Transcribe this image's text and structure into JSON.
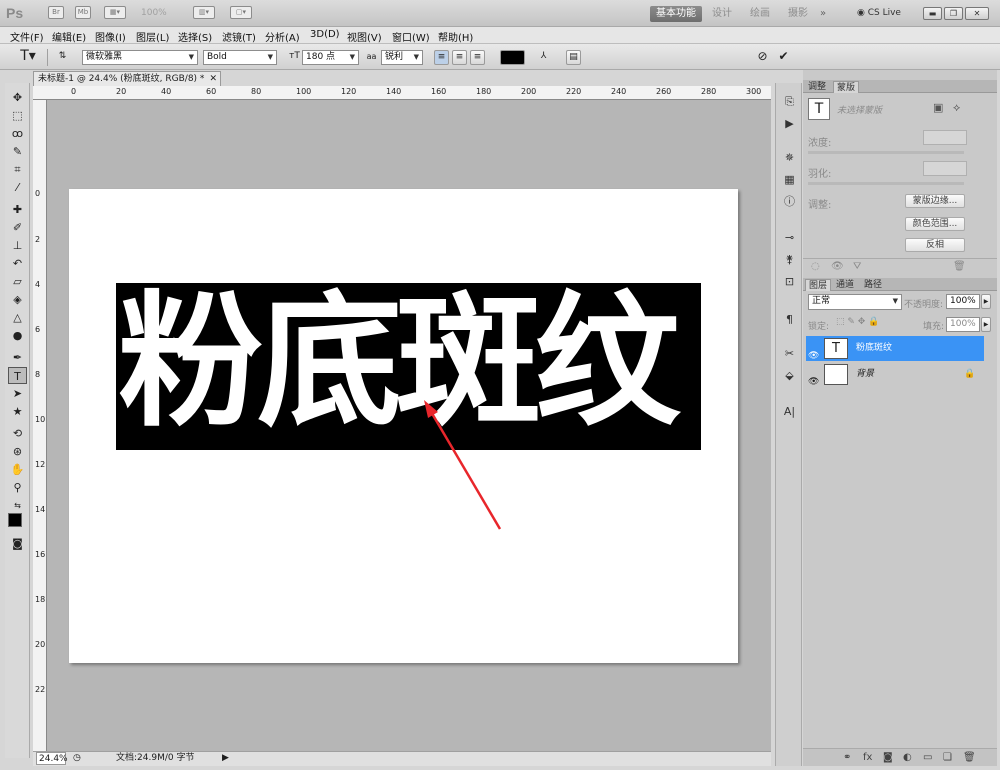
{
  "app": {
    "logo": "Ps",
    "zoom": "100%",
    "workspaces": [
      "基本功能",
      "设计",
      "绘画",
      "摄影"
    ],
    "cs_live": "CS Live"
  },
  "menu": [
    "文件(F)",
    "编辑(E)",
    "图像(I)",
    "图层(L)",
    "选择(S)",
    "滤镜(T)",
    "分析(A)",
    "3D(D)",
    "视图(V)",
    "窗口(W)",
    "帮助(H)"
  ],
  "options": {
    "font_family": "微软雅黑",
    "font_style": "Bold",
    "font_size": "180 点",
    "aa_label": "a",
    "aa": "锐利",
    "color": "#000000"
  },
  "document": {
    "tab_title": "未标题-1 @ 24.4% (粉底斑纹, RGB/8) *",
    "text": "粉底斑纹",
    "zoom": "24.4%",
    "status": "文档:24.9M/0 字节"
  },
  "ruler_h": [
    "0",
    "20",
    "40",
    "60",
    "80",
    "100",
    "120",
    "140",
    "160",
    "180",
    "200",
    "220",
    "240",
    "260",
    "280",
    "300"
  ],
  "ruler_v": [
    "0",
    "2",
    "4",
    "6",
    "8",
    "10",
    "12",
    "14",
    "16",
    "18",
    "20",
    "22"
  ],
  "masks": {
    "tabs": [
      "调整",
      "蒙版"
    ],
    "hint": "未选择蒙版",
    "density": "浓度:",
    "feather": "羽化:",
    "refine": "调整:",
    "btn_edge": "蒙版边缘...",
    "btn_color": "颜色范围...",
    "btn_invert": "反相"
  },
  "layers": {
    "tabs": [
      "图层",
      "通道",
      "路径"
    ],
    "blend": "正常",
    "opacity_label": "不透明度:",
    "opacity": "100%",
    "lock_label": "锁定:",
    "fill_label": "填充:",
    "fill": "100%",
    "items": [
      {
        "name": "粉底斑纹",
        "thumb": "T"
      },
      {
        "name": "背景",
        "thumb": ""
      }
    ]
  },
  "colors": {
    "selected_layer": "#3a93f5",
    "annotation_arrow": "#e8262b"
  }
}
